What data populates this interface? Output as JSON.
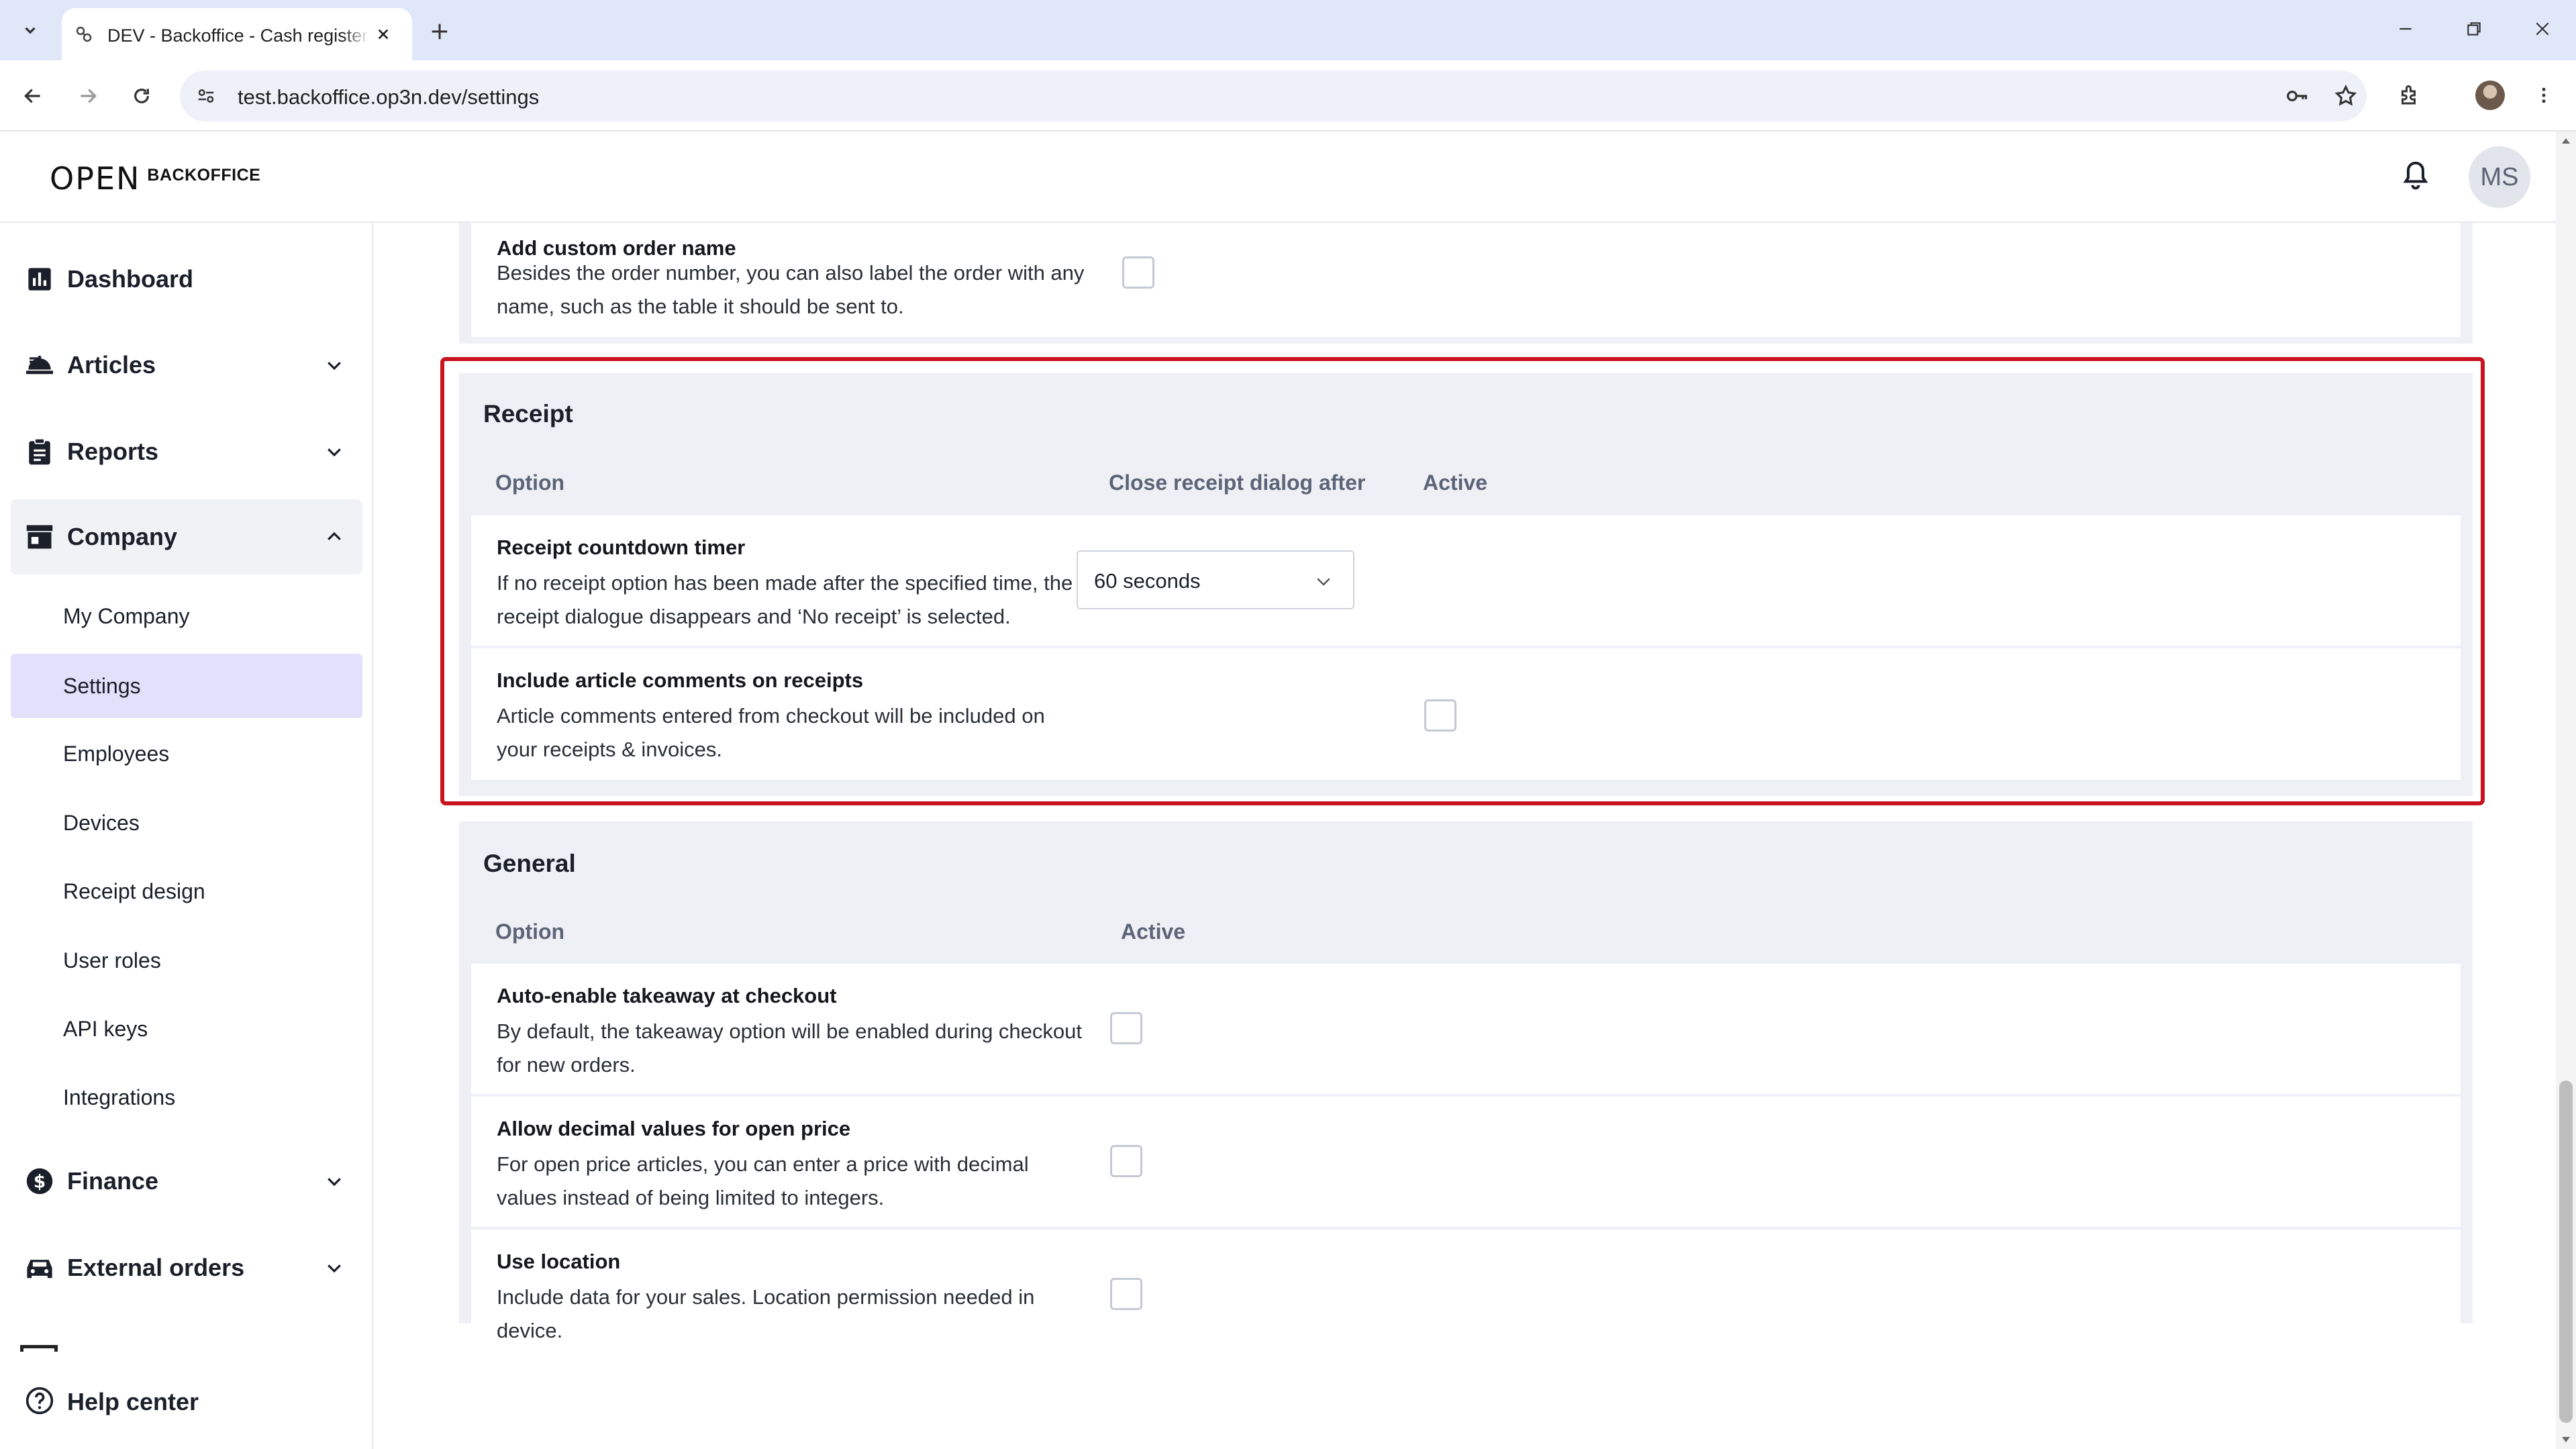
{
  "browser": {
    "tab_title": "DEV - Backoffice - Cash register",
    "url": "test.backoffice.op3n.dev/settings"
  },
  "app": {
    "logo_brand": "OPEN",
    "logo_sub": "BACKOFFICE",
    "user_initials": "MS"
  },
  "sidebar": {
    "items": [
      {
        "label": "Dashboard",
        "icon": "bar-chart-icon"
      },
      {
        "label": "Articles",
        "icon": "food-tray-icon"
      },
      {
        "label": "Reports",
        "icon": "clipboard-icon"
      },
      {
        "label": "Company",
        "icon": "store-icon"
      },
      {
        "label": "Finance",
        "icon": "dollar-circle-icon"
      },
      {
        "label": "External orders",
        "icon": "car-icon"
      }
    ],
    "company_sub": [
      "My Company",
      "Settings",
      "Employees",
      "Devices",
      "Receipt design",
      "User roles",
      "API keys",
      "Integrations"
    ],
    "active_sub": "Settings",
    "help": "Help center"
  },
  "top_section": {
    "row": {
      "title": "Add custom order name",
      "desc": "Besides the order number, you can also label the order with any name, such as the table it should be sent to.",
      "checked": false
    }
  },
  "receipt": {
    "title": "Receipt",
    "col_option": "Option",
    "col_close": "Close receipt dialog after",
    "col_active": "Active",
    "rows": [
      {
        "title": "Receipt countdown timer",
        "desc": "If no receipt option has been made after the specified time, the receipt dialogue disappears and ‘No receipt’ is selected.",
        "select_value": "60 seconds"
      },
      {
        "title": "Include article comments on receipts",
        "desc": "Article comments entered from checkout will be included on your receipts & invoices.",
        "checked": false
      }
    ]
  },
  "general": {
    "title": "General",
    "col_option": "Option",
    "col_active": "Active",
    "rows": [
      {
        "title": "Auto-enable takeaway at checkout",
        "desc": "By default, the takeaway option will be enabled during checkout for new orders.",
        "checked": false
      },
      {
        "title": "Allow decimal values for open price",
        "desc": "For open price articles, you can enter a price with decimal values instead of being limited to integers.",
        "checked": false
      },
      {
        "title": "Use location",
        "desc": "Include data for your sales. Location permission needed in device.",
        "checked": false
      }
    ]
  },
  "colors": {
    "highlight": "#c8141e",
    "active_nav": "#e3e0fb",
    "section_bg": "#eef0f5"
  }
}
